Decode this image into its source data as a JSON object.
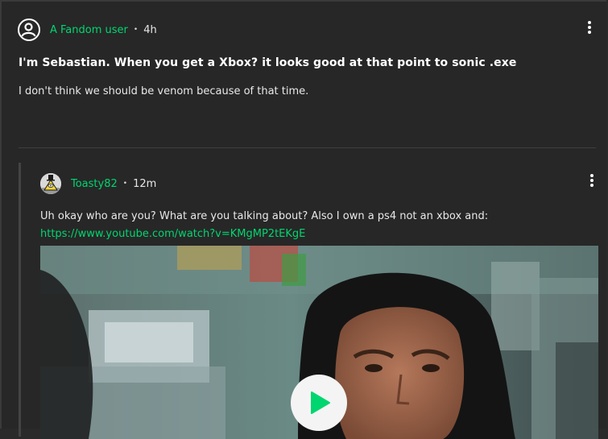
{
  "post": {
    "author": "A Fandom user",
    "separator": "•",
    "time": "4h",
    "title": "I'm Sebastian. When you get a Xbox? it looks good at that point to sonic .exe",
    "body": "I don't think we should be venom because of that time."
  },
  "reply": {
    "author": "Toasty82",
    "separator": "•",
    "time": "12m",
    "text": "Uh okay who are you? What are you talking about? Also I own a ps4 not an xbox and:",
    "link": "https://www.youtube.com/watch?v=KMgMP2tEKgE"
  },
  "icons": {
    "generic_avatar": "user-circle-icon",
    "toasty_avatar": "bill-cipher-avatar",
    "menu": "kebab-menu-icon",
    "play": "play-icon"
  },
  "colors": {
    "background": "#272727",
    "accent_green": "#00d66f",
    "text": "#e8e8e8"
  }
}
